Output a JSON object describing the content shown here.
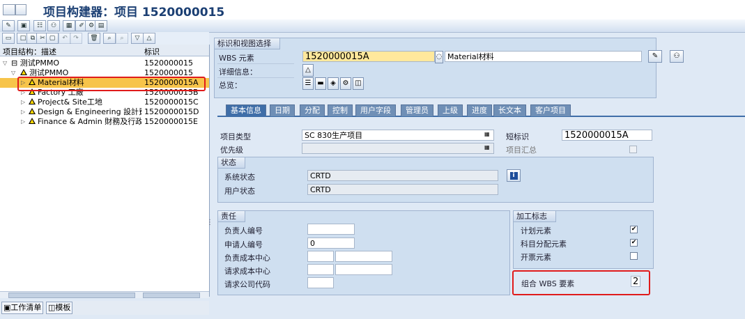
{
  "window": {
    "title": "项目构建器：项目 1520000015"
  },
  "tree": {
    "headers": {
      "structure": "项目结构：描述",
      "id": "标识"
    },
    "rows": [
      {
        "name": "测试PMMO",
        "id": "1520000015"
      },
      {
        "name": "测试PMMO",
        "id": "1520000015"
      },
      {
        "name": "Material材料",
        "id": "1520000015A"
      },
      {
        "name": "Factory 工廠",
        "id": "1520000015B"
      },
      {
        "name": "Project& Site工地",
        "id": "1520000015C"
      },
      {
        "name": "Design & Engineering 設計費",
        "id": "1520000015D"
      },
      {
        "name": "Finance & Admin 財務及行政費",
        "id": "1520000015E"
      }
    ]
  },
  "bottom_tabs": {
    "worklist": "工作清单",
    "template": "模板"
  },
  "ident": {
    "group_title": "标识和视图选择",
    "wbs_label": "WBS 元素",
    "wbs_value": "1520000015A",
    "wbs_desc": "Material材料",
    "detail_label": "详细信息：",
    "overview_label": "总览："
  },
  "tabs": [
    "基本信息",
    "日期",
    "分配",
    "控制",
    "用户字段",
    "管理员",
    "上级",
    "进度",
    "长文本",
    "客户项目"
  ],
  "basic": {
    "project_type_label": "项目类型",
    "project_type_value": "SC 830生产项目",
    "priority_label": "优先级",
    "short_id_label": "短标识",
    "short_id_value": "1520000015A",
    "project_summary_label": "项目汇总"
  },
  "status": {
    "title": "状态",
    "system_label": "系统状态",
    "system_value": "CRTD",
    "user_label": "用户状态",
    "user_value": "CRTD",
    "info_icon": "i"
  },
  "responsibility": {
    "title": "责任",
    "responsible_no_label": "负责人编号",
    "applicant_no_label": "申请人编号",
    "applicant_no_value": "0",
    "resp_cost_center_label": "负责成本中心",
    "req_cost_center_label": "请求成本中心",
    "req_company_code_label": "请求公司代码"
  },
  "operative": {
    "title": "加工标志",
    "planning_label": "计划元素",
    "planning_checked": true,
    "acct_label": "科目分配元素",
    "acct_checked": true,
    "billing_label": "开票元素",
    "billing_checked": false
  },
  "grouping": {
    "label": "组合 WBS 要素",
    "value": "2"
  },
  "colors": {
    "accent": "#3f6ea8",
    "selected_row": "#f7c44a",
    "highlight_box": "#e01b1b"
  }
}
